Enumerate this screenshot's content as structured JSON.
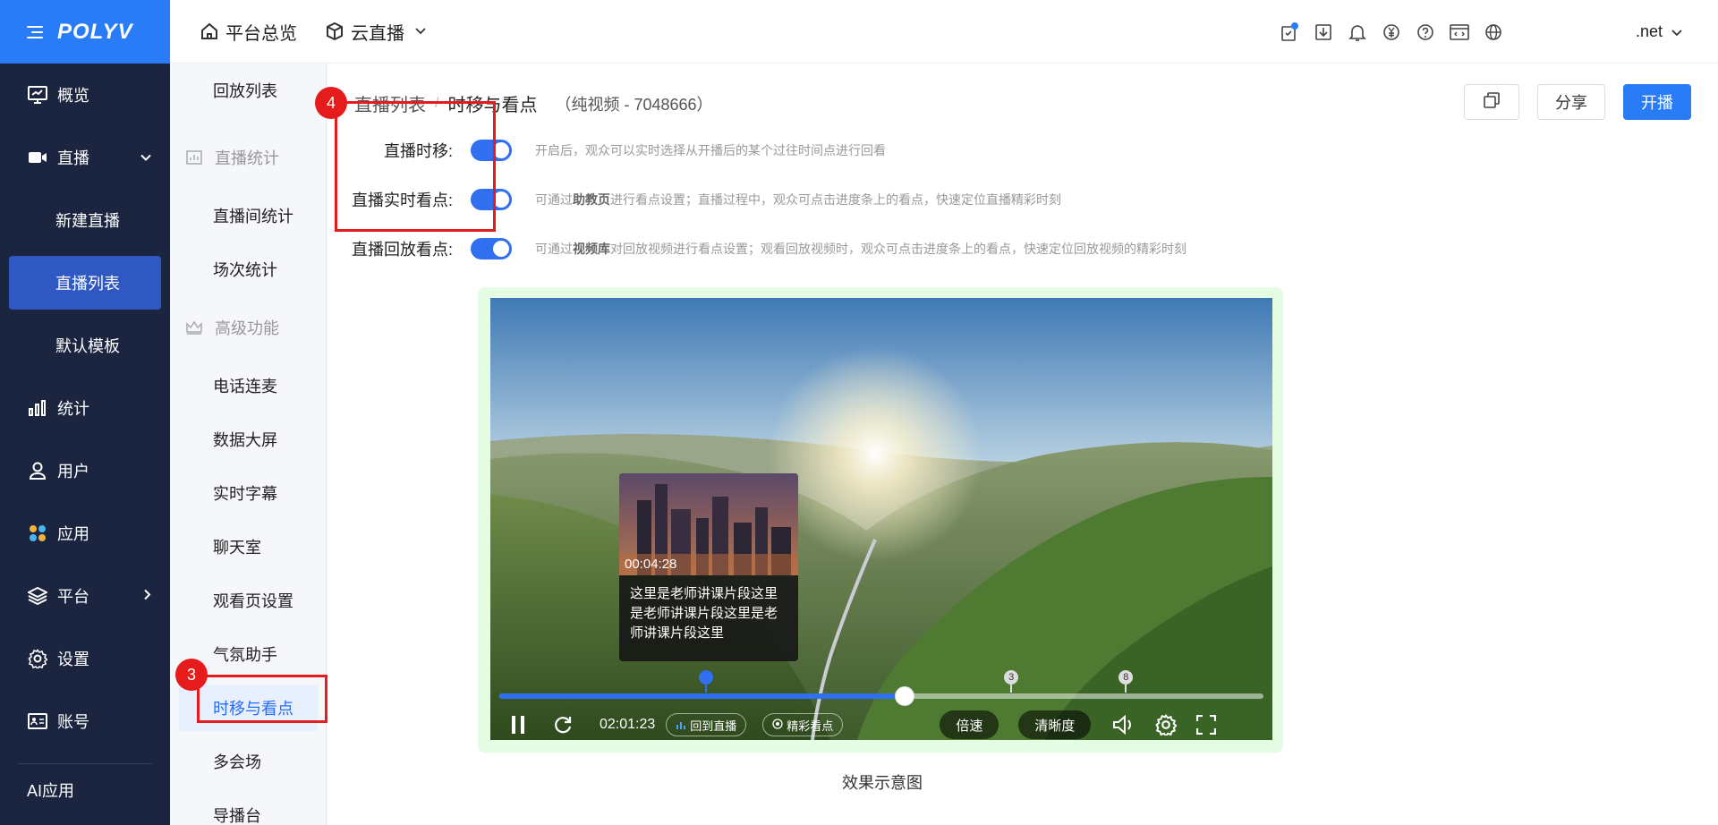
{
  "brand": {
    "logo": "POLYV",
    "accent": "#2a7cf6",
    "sidebar_bg": "#1b2540"
  },
  "nav": {
    "items": [
      {
        "label": "概览",
        "icon": "monitor-icon"
      },
      {
        "label": "直播",
        "icon": "video-camera-icon",
        "expanded": true
      },
      {
        "label": "新建直播"
      },
      {
        "label": "直播列表",
        "active": true
      },
      {
        "label": "默认模板"
      },
      {
        "label": "统计",
        "icon": "bar-chart-icon"
      },
      {
        "label": "用户",
        "icon": "user-icon"
      },
      {
        "label": "应用",
        "icon": "apps-icon"
      },
      {
        "label": "平台",
        "icon": "layers-icon"
      },
      {
        "label": "设置",
        "icon": "gear-icon"
      },
      {
        "label": "账号",
        "icon": "id-card-icon"
      }
    ],
    "ai_label": "AI应用"
  },
  "topbar": {
    "home_label": "平台总览",
    "product_label": "云直播",
    "user_label": ".net"
  },
  "subnav": {
    "top_item": "回放列表",
    "group1": "直播统计",
    "group1_items": [
      "直播间统计",
      "场次统计"
    ],
    "group2": "高级功能",
    "group2_items": [
      "电话连麦",
      "数据大屏",
      "实时字幕",
      "聊天室",
      "观看页设置",
      "气氛助手",
      "时移与看点",
      "多会场",
      "导播台"
    ]
  },
  "main": {
    "breadcrumb_root": "直播列表",
    "breadcrumb_sep": "/",
    "breadcrumb_current": "时移与看点",
    "breadcrumb_meta": "（纯视频 - 7048666）",
    "share_label": "分享",
    "start_label": "开播",
    "settings": [
      {
        "label": "直播时移:",
        "enabled": true,
        "desc_pre": "开启后，观众可以实时选择从开播后的某个过往时间点进行回看",
        "desc_bold": "",
        "desc_post": ""
      },
      {
        "label": "直播实时看点:",
        "enabled": true,
        "desc_pre": "可通过",
        "desc_bold": "助教页",
        "desc_post": "进行看点设置；直播过程中，观众可点击进度条上的看点，快速定位直播精彩时刻"
      },
      {
        "label": "直播回放看点:",
        "enabled": true,
        "desc_pre": "可通过",
        "desc_bold": "视频库",
        "desc_post": "对回放视频进行看点设置；观看回放视频时，观众可点击进度条上的看点，快速定位回放视频的精彩时刻"
      }
    ],
    "badge3": "3",
    "badge4": "4",
    "caption": "效果示意图"
  },
  "player": {
    "tooltip_time": "00:04:28",
    "tooltip_text": "这里是老师讲课片段这里是老师讲课片段这里是老师讲课片段这里",
    "current_time": "02:01:23",
    "back_live_label": "回到直播",
    "highlights_label": "精彩看点",
    "speed_label": "倍速",
    "quality_label": "清晰度",
    "progress": 0.53,
    "markers": [
      {
        "pos": 0.27,
        "label": "",
        "style": "blue"
      },
      {
        "pos": 0.67,
        "label": "3",
        "style": "grey"
      },
      {
        "pos": 0.82,
        "label": "8",
        "style": "grey"
      }
    ]
  }
}
